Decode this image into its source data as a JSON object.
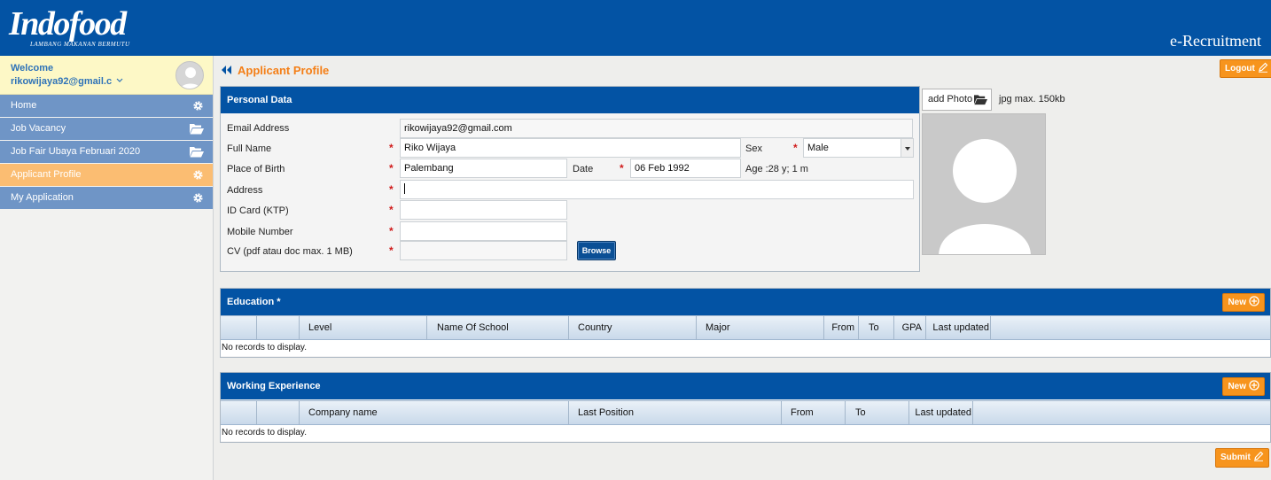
{
  "header": {
    "logo": "Indofood",
    "tagline": "LAMBANG  MAKANAN BERMUTU",
    "app_title": "e-Recruitment"
  },
  "sidebar": {
    "welcome_label": "Welcome",
    "user": "rikowijaya92@gmail.c",
    "items": [
      {
        "label": "Home",
        "icon": "gear-icon"
      },
      {
        "label": "Job Vacancy",
        "icon": "folder-open-icon"
      },
      {
        "label": "Job Fair Ubaya Februari 2020",
        "icon": "folder-open-icon"
      },
      {
        "label": "Applicant Profile",
        "icon": "gear-icon",
        "active": true
      },
      {
        "label": "My Application",
        "icon": "gear-icon"
      }
    ]
  },
  "page": {
    "title": "Applicant Profile",
    "logout_label": "Logout",
    "submit_label": "Submit"
  },
  "personal": {
    "title": "Personal Data",
    "email_label": "Email Address",
    "email_value": "rikowijaya92@gmail.com",
    "fullname_label": "Full Name",
    "fullname_value": "Riko Wijaya",
    "sex_label": "Sex",
    "sex_value": "Male",
    "birthplace_label": "Place of Birth",
    "birthplace_value": "Palembang",
    "date_label": "Date",
    "date_value": "06 Feb 1992",
    "age_text": "Age :28 y; 1 m",
    "address_label": "Address",
    "address_value": "",
    "idcard_label": "ID Card (KTP)",
    "idcard_value": "",
    "mobile_label": "Mobile Number",
    "mobile_value": "",
    "cv_label": "CV (pdf atau doc max. 1 MB)",
    "cv_value": "",
    "browse_label": "Browse",
    "required_mark": "*"
  },
  "photo": {
    "button_label": "add Photo",
    "note": "jpg max. 150kb"
  },
  "education": {
    "title": "Education *",
    "new_label": "New",
    "columns": [
      "Level",
      "Name Of School",
      "Country",
      "Major",
      "From",
      "To",
      "GPA",
      "Last updated"
    ],
    "empty": "No records to display."
  },
  "experience": {
    "title": "Working Experience",
    "new_label": "New",
    "columns": [
      "Company name",
      "Last Position",
      "From",
      "To",
      "Last updated"
    ],
    "empty": "No records to display."
  },
  "colors": {
    "brand_blue": "#0353a4",
    "accent_orange": "#f7941d",
    "nav_blue": "#6f95c6",
    "nav_active": "#fbbd72",
    "required_red": "#d01a1a"
  }
}
